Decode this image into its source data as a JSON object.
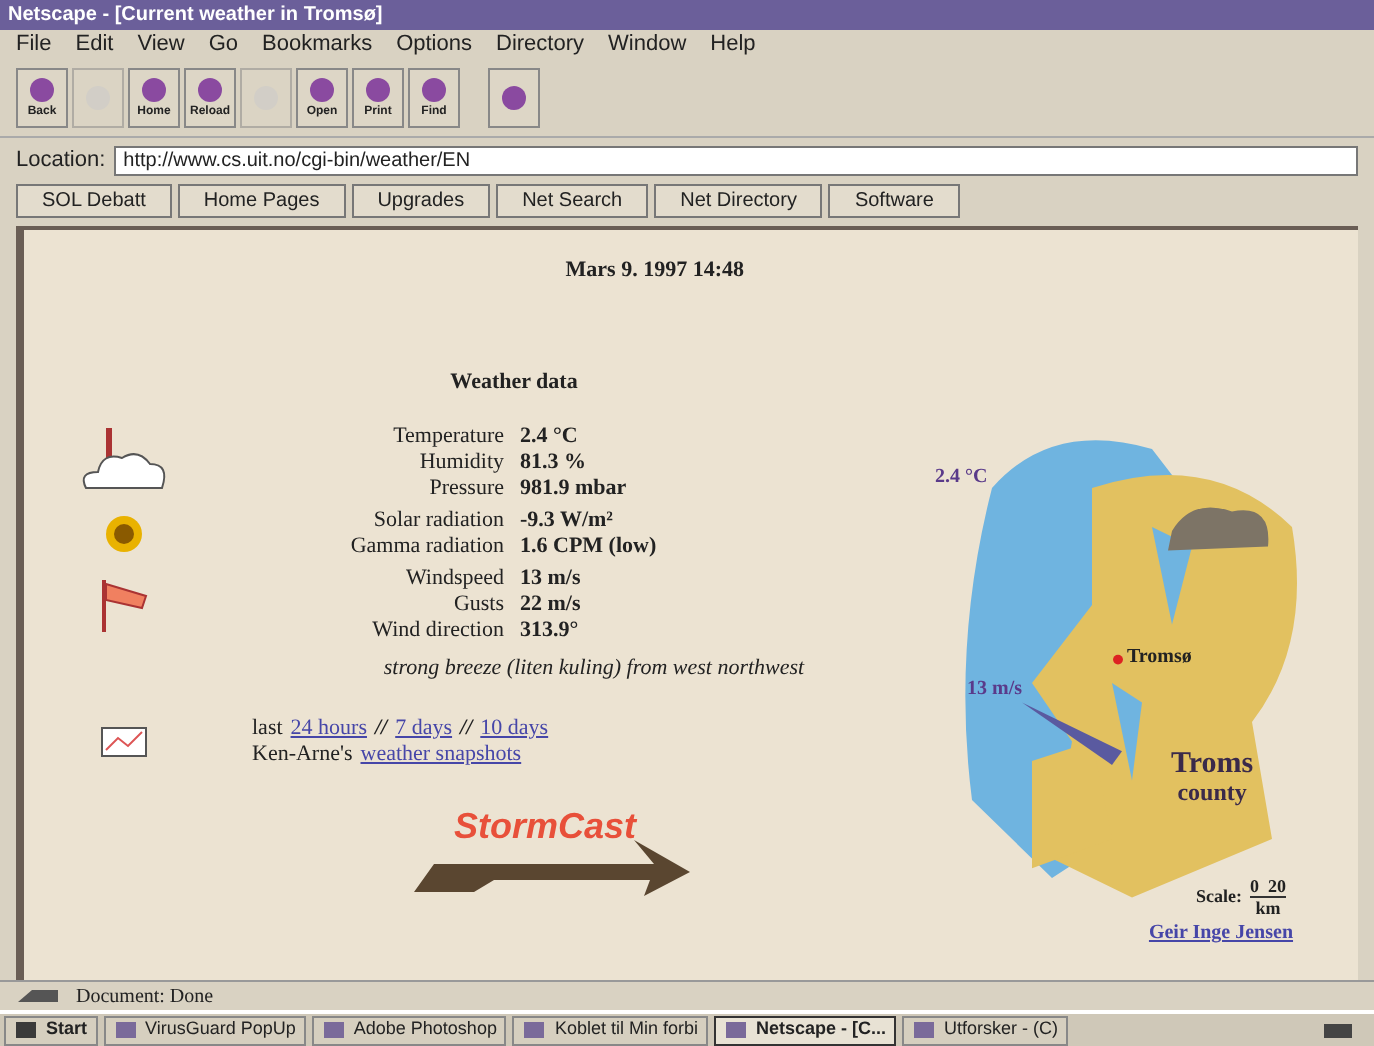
{
  "window": {
    "title": "Netscape - [Current weather in Tromsø]"
  },
  "menu": [
    "File",
    "Edit",
    "View",
    "Go",
    "Bookmarks",
    "Options",
    "Directory",
    "Window",
    "Help"
  ],
  "toolbar": [
    {
      "label": "Back",
      "disabled": false
    },
    {
      "disabled": true
    },
    {
      "label": "Home",
      "disabled": false
    },
    {
      "label": "Reload",
      "disabled": false
    },
    {
      "disabled": true
    },
    {
      "label": "Open",
      "disabled": false
    },
    {
      "label": "Print",
      "disabled": false
    },
    {
      "label": "Find",
      "disabled": false
    },
    {
      "disabled": false
    }
  ],
  "location": {
    "label": "Location:",
    "value": "http://www.cs.uit.no/cgi-bin/weather/EN"
  },
  "directory_buttons": [
    "SOL Debatt",
    "Home Pages",
    "Upgrades",
    "Net Search",
    "Net Directory",
    "Software"
  ],
  "page": {
    "date": "Mars 9. 1997 14:48",
    "heading": "Weather data",
    "groups": [
      {
        "kind": "cloud",
        "rows": [
          {
            "label": "Temperature",
            "value": "2.4 °C"
          },
          {
            "label": "Humidity",
            "value": "81.3 %"
          },
          {
            "label": "Pressure",
            "value": "981.9 mbar"
          }
        ]
      },
      {
        "kind": "sun",
        "rows": [
          {
            "label": "Solar radiation",
            "value": "-9.3 W/m²"
          },
          {
            "label": "Gamma radiation",
            "value": "1.6 CPM (low)"
          }
        ]
      },
      {
        "kind": "windsock",
        "rows": [
          {
            "label": "Windspeed",
            "value": "13 m/s"
          },
          {
            "label": "Gusts",
            "value": "22 m/s"
          },
          {
            "label": "Wind direction",
            "value": "313.9°"
          }
        ]
      }
    ],
    "summary": "strong breeze (liten kuling) from west northwest",
    "history": {
      "prefix": "last",
      "links": [
        "24 hours",
        "7 days",
        "10 days"
      ],
      "separator": "//",
      "snapshot_prefix": "Ken-Arne's",
      "snapshot_link": "weather snapshots"
    },
    "logo": "StormCast",
    "map": {
      "temperature": "2.4 °C",
      "city": "Tromsø",
      "wind": "13 m/s",
      "region": "Troms",
      "region_sub": "county",
      "scale_label": "Scale:",
      "scale_values": "0  20",
      "scale_unit": "km"
    },
    "author": "Geir Inge Jensen"
  },
  "status_bar": {
    "text": "Document: Done"
  },
  "taskbar": [
    {
      "label": "Start",
      "selected": false
    },
    {
      "label": "VirusGuard PopUp",
      "selected": false
    },
    {
      "label": "Adobe Photoshop",
      "selected": false
    },
    {
      "label": "Koblet til Min forbi",
      "selected": false
    },
    {
      "label": "Netscape - [C...",
      "selected": true
    },
    {
      "label": "Utforsker - (C)",
      "selected": false
    }
  ]
}
